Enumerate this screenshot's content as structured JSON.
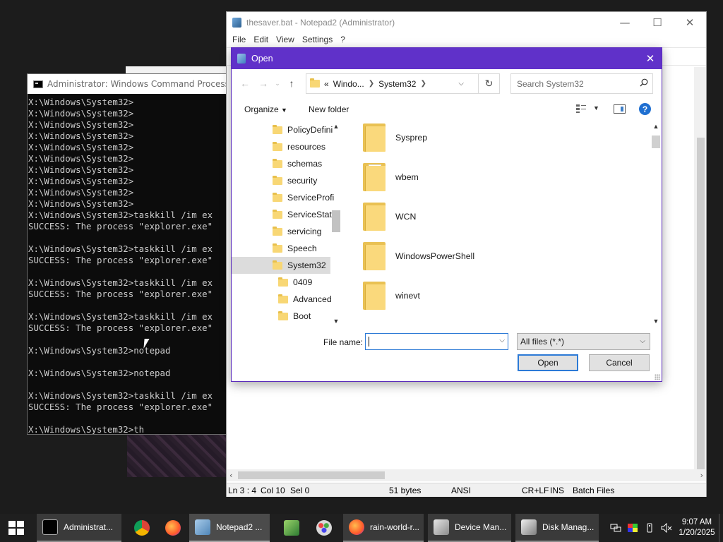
{
  "cmd": {
    "title": "Administrator: Windows Command Processor",
    "lines": [
      "X:\\Windows\\System32>",
      "X:\\Windows\\System32>",
      "X:\\Windows\\System32>",
      "X:\\Windows\\System32>",
      "X:\\Windows\\System32>",
      "X:\\Windows\\System32>",
      "X:\\Windows\\System32>",
      "X:\\Windows\\System32>",
      "X:\\Windows\\System32>",
      "X:\\Windows\\System32>",
      "X:\\Windows\\System32>taskkill /im ex",
      "SUCCESS: The process \"explorer.exe\"",
      "",
      "X:\\Windows\\System32>taskkill /im ex",
      "SUCCESS: The process \"explorer.exe\"",
      "",
      "X:\\Windows\\System32>taskkill /im ex",
      "SUCCESS: The process \"explorer.exe\"",
      "",
      "X:\\Windows\\System32>taskkill /im ex",
      "SUCCESS: The process \"explorer.exe\"",
      "",
      "X:\\Windows\\System32>notepad",
      "",
      "X:\\Windows\\System32>notepad",
      "",
      "X:\\Windows\\System32>taskkill /im ex",
      "SUCCESS: The process \"explorer.exe\"",
      "",
      "X:\\Windows\\System32>th"
    ]
  },
  "notepad": {
    "title": "thesaver.bat - Notepad2 (Administrator)",
    "menu": [
      "File",
      "Edit",
      "View",
      "Settings",
      "?"
    ],
    "status": {
      "position": "Ln 3 : 4",
      "col": "Col 10",
      "sel": "Sel 0",
      "size": "51 bytes",
      "encoding": "ANSI",
      "eol": "CR+LF",
      "ins": "INS",
      "scheme": "Batch Files"
    }
  },
  "dialog": {
    "title": "Open",
    "breadcrumb": {
      "prefix": "«",
      "parts": [
        "Windo...",
        "System32"
      ]
    },
    "search_placeholder": "Search System32",
    "organize": "Organize",
    "new_folder": "New folder",
    "tree": [
      {
        "label": "PolicyDefini",
        "indent": 0
      },
      {
        "label": "resources",
        "indent": 0
      },
      {
        "label": "schemas",
        "indent": 0
      },
      {
        "label": "security",
        "indent": 0
      },
      {
        "label": "ServiceProfi",
        "indent": 0
      },
      {
        "label": "ServiceState",
        "indent": 0
      },
      {
        "label": "servicing",
        "indent": 0
      },
      {
        "label": "Speech",
        "indent": 0
      },
      {
        "label": "System32",
        "indent": 0,
        "selected": true
      },
      {
        "label": "0409",
        "indent": 1
      },
      {
        "label": "Advanced",
        "indent": 1
      },
      {
        "label": "Boot",
        "indent": 1
      }
    ],
    "files": [
      {
        "name": "Sysprep",
        "kind": "plain"
      },
      {
        "name": "wbem",
        "kind": "docs"
      },
      {
        "name": "WCN",
        "kind": "plain"
      },
      {
        "name": "WindowsPowerShell",
        "kind": "plain"
      },
      {
        "name": "winevt",
        "kind": "plain"
      }
    ],
    "file_name_label": "File name:",
    "file_name_value": "",
    "filter": "All files (*.*)",
    "open_button": "Open",
    "cancel_button": "Cancel"
  },
  "taskbar": {
    "buttons": [
      {
        "label": "Administrat...",
        "icon": "cmd-icon"
      },
      {
        "label": "Notepad2 ...",
        "icon": "notepad2-icon"
      },
      {
        "label": "rain-world-r...",
        "icon": "firefox-icon"
      },
      {
        "label": "Device Man...",
        "icon": "device-manager-icon"
      },
      {
        "label": "Disk Manag...",
        "icon": "disk-management-icon"
      }
    ],
    "time": "9:07 AM",
    "date": "1/20/2025"
  },
  "colors": {
    "dialog_title_bg": "#6031c9",
    "accent_blue": "#2c7ad6",
    "folder_yellow": "#f8d775",
    "taskbar_bg": "#1f1f1f"
  }
}
